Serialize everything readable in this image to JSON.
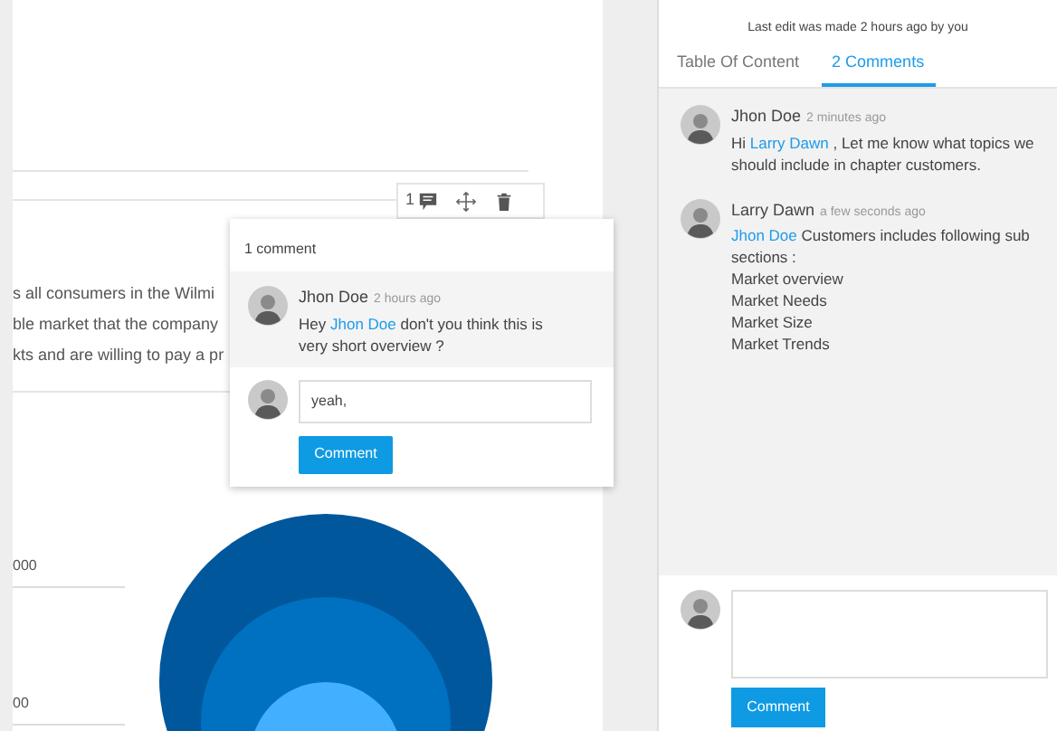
{
  "document": {
    "text_lines": [
      "s all consumers in the Wilmi",
      "ble market that the company",
      "kts and are willing to pay a pr"
    ],
    "toolbar": {
      "comment_count": "1"
    },
    "chart": {
      "axis_labels": [
        "000",
        "00"
      ]
    }
  },
  "popup": {
    "title": "1 comment",
    "comments": [
      {
        "author": "Jhon Doe",
        "time": "2 hours ago",
        "prefix": "Hey ",
        "mention": "Jhon Doe",
        "text": "  don't you think this is very short overview ?"
      }
    ],
    "reply": {
      "value": "yeah, ",
      "button": "Comment"
    }
  },
  "side_panel": {
    "last_edit": "Last edit was made 2 hours ago by you",
    "tabs": [
      {
        "label": "Table Of Content",
        "selected": false
      },
      {
        "label": "2 Comments",
        "selected": true
      }
    ],
    "comments": [
      {
        "author": "Jhon Doe",
        "time": "2 minutes ago",
        "prefix": "Hi ",
        "mention": "Larry Dawn",
        "text": " , Let me know what topics we should include in chapter customers."
      },
      {
        "author": "Larry Dawn",
        "time": "a few seconds ago",
        "mention": "Jhon Doe",
        "text": " Customers includes following sub sections :",
        "lines": [
          "Market overview",
          "Market Needs",
          "Market Size",
          "Market Trends"
        ]
      }
    ],
    "reply": {
      "button": "Comment"
    }
  }
}
